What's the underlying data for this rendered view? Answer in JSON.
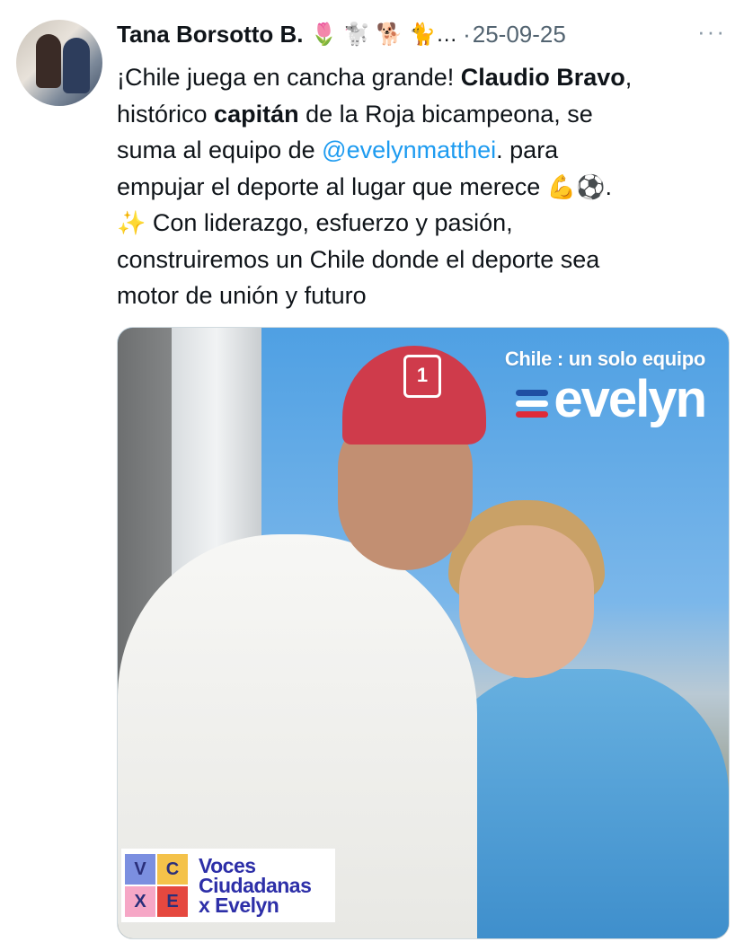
{
  "tweet": {
    "author": {
      "display_name": "Tana Borsotto B.",
      "name_emojis": "🌷 🐩 🐕 🐈…",
      "avatar_icon": "profile-photo-avatar"
    },
    "separator": "·",
    "date": "25-09-25",
    "more_label": "···",
    "text": {
      "line1_pre": "¡Chile juega en cancha grande! ",
      "bold_name": "Claudio Bravo",
      "line1_post": ",",
      "line2_pre": "histórico ",
      "bold_capitan": "capitán",
      "line2_post": " de la Roja bicampeona, se",
      "line3_pre": "suma al equipo de ",
      "mention": "@evelynmatthei",
      "line3_post": ". para",
      "line4": "empujar el deporte al lugar que merece ",
      "line4_emojis": "💪⚽",
      "line4_end": ".",
      "line5_emoji": "✨",
      "line5": " Con liderazgo, esfuerzo y pasión,",
      "line6": "construiremos un Chile donde el deporte sea",
      "line7": "motor de unión y futuro"
    },
    "media": {
      "brand_tagline": "Chile : un solo equipo",
      "brand_word": "evelyn",
      "brand_stripe_colors": [
        "#1f4fa3",
        "#ffffff",
        "#e02a38"
      ],
      "cap_logo": "1",
      "badge": {
        "letters": [
          "V",
          "C",
          "X",
          "E"
        ],
        "cell_colors": [
          "#7b8fe0",
          "#f4c24a",
          "#f6a7c6",
          "#e5483f"
        ],
        "line1": "Voces",
        "line2": "Ciudadanas",
        "line3": "x Evelyn"
      }
    }
  },
  "colors": {
    "mention": "#1d9bf0",
    "secondary_text": "#536471",
    "primary_text": "#0f1419"
  }
}
